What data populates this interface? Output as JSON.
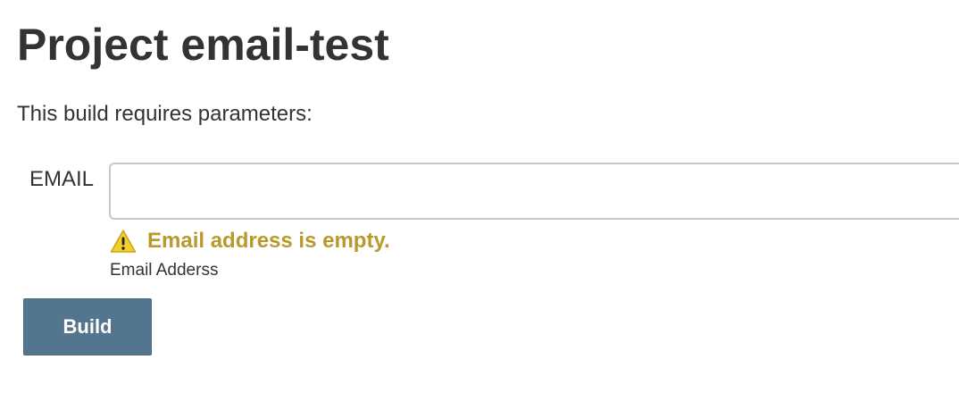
{
  "page": {
    "title": "Project email-test",
    "intro": "This build requires parameters:"
  },
  "parameter": {
    "name": "EMAIL",
    "value": "",
    "placeholder": "",
    "warning": "Email address is empty.",
    "description": "Email Adderss"
  },
  "actions": {
    "build_label": "Build"
  },
  "colors": {
    "warning": "#b89a2c",
    "warning_icon_fill": "#f2cf2b",
    "button": "#54758e",
    "text": "#333333"
  },
  "icons": {
    "warning": "warning-triangle-icon"
  }
}
